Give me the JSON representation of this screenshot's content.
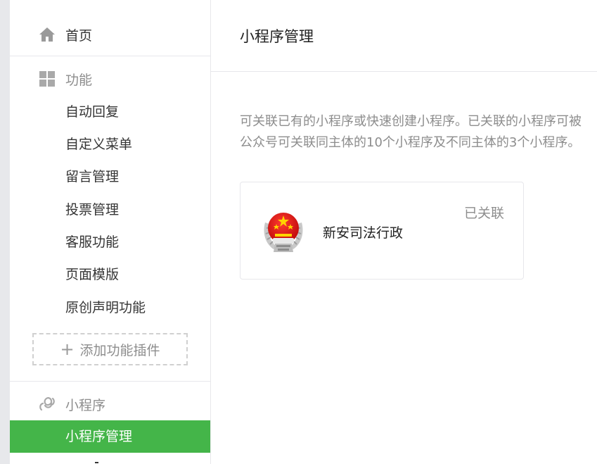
{
  "sidebar": {
    "home": {
      "label": "首页",
      "icon": "home-icon"
    },
    "features": {
      "label": "功能",
      "icon": "grid-icon",
      "items": [
        {
          "label": "自动回复"
        },
        {
          "label": "自定义菜单"
        },
        {
          "label": "留言管理"
        },
        {
          "label": "投票管理"
        },
        {
          "label": "客服功能"
        },
        {
          "label": "页面模版"
        },
        {
          "label": "原创声明功能"
        }
      ],
      "add_plugin_label": "添加功能插件"
    },
    "mini_programs": {
      "label": "小程序",
      "icon": "link-icon",
      "items": [
        {
          "label": "小程序管理",
          "active": true
        }
      ]
    }
  },
  "main": {
    "title": "小程序管理",
    "description_line1": "可关联已有的小程序或快速创建小程序。已关联的小程序可被",
    "description_line2": "公众号可关联同主体的10个小程序及不同主体的3个小程序。",
    "cards": [
      {
        "name": "新安司法行政",
        "status": "已关联",
        "logo": "judicial-emblem-logo"
      }
    ]
  },
  "colors": {
    "accent": "#44b549",
    "muted_text": "#8d8d8d",
    "divider": "#e7e7eb"
  }
}
